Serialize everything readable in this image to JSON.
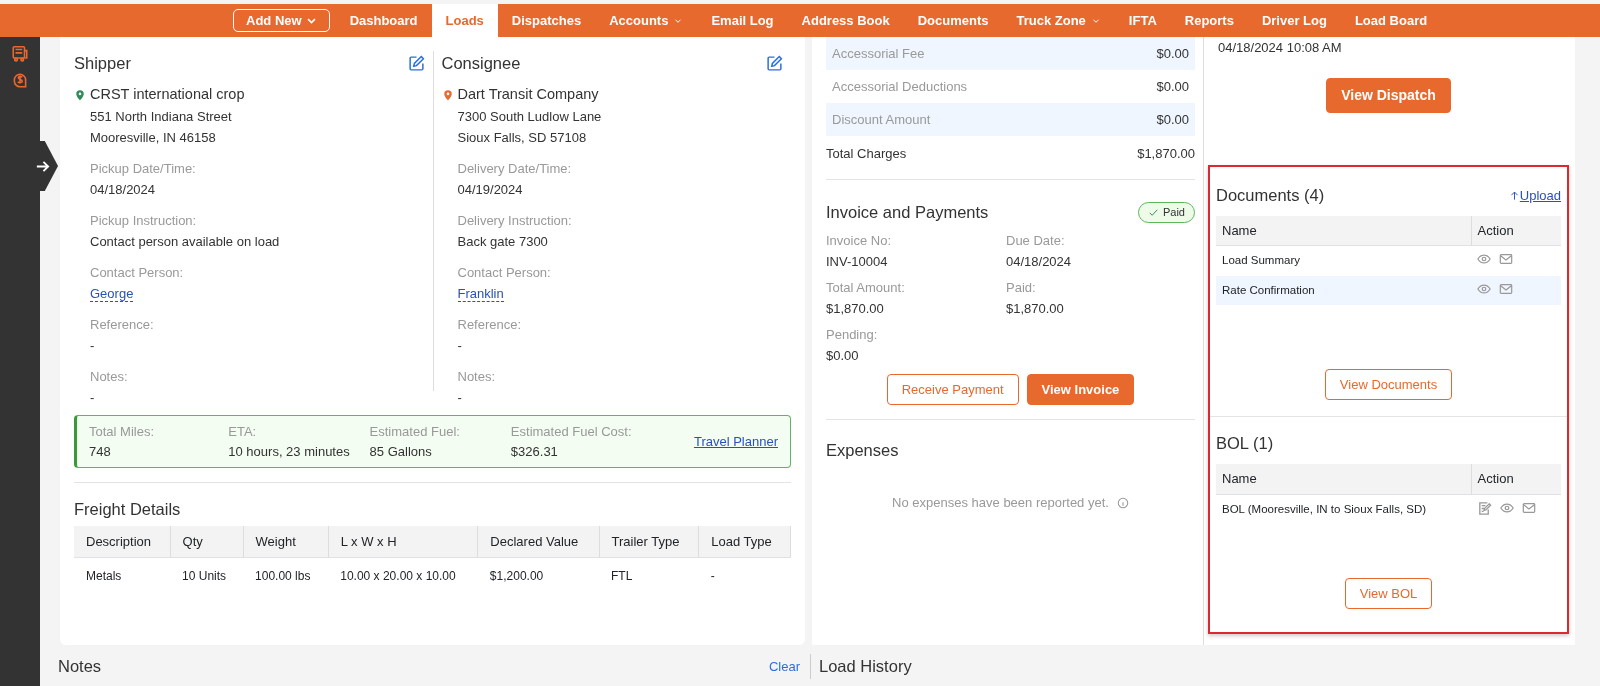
{
  "nav": {
    "add_new": "Add New",
    "items": [
      {
        "label": "Dashboard",
        "dropdown": false,
        "selected": false
      },
      {
        "label": "Loads",
        "dropdown": false,
        "selected": true
      },
      {
        "label": "Dispatches",
        "dropdown": false,
        "selected": false
      },
      {
        "label": "Accounts",
        "dropdown": true,
        "selected": false
      },
      {
        "label": "Email Log",
        "dropdown": false,
        "selected": false
      },
      {
        "label": "Address Book",
        "dropdown": false,
        "selected": false
      },
      {
        "label": "Documents",
        "dropdown": false,
        "selected": false
      },
      {
        "label": "Truck Zone",
        "dropdown": true,
        "selected": false
      },
      {
        "label": "IFTA",
        "dropdown": false,
        "selected": false
      },
      {
        "label": "Reports",
        "dropdown": false,
        "selected": false
      },
      {
        "label": "Driver Log",
        "dropdown": false,
        "selected": false
      },
      {
        "label": "Load Board",
        "dropdown": false,
        "selected": false
      }
    ]
  },
  "stops": [
    {
      "title": "Shipper",
      "color": "#2e8b57",
      "company": "CRST international crop",
      "address_lines": [
        "551 North Indiana Street",
        "Mooresville, IN 46158"
      ],
      "fields": [
        {
          "label": "Pickup Date/Time:",
          "value": "04/18/2024",
          "kind": "text"
        },
        {
          "label": "Pickup Instruction:",
          "value": "Contact person available on load",
          "kind": "text"
        },
        {
          "label": "Contact Person:",
          "value": "George",
          "kind": "link"
        },
        {
          "label": "Reference:",
          "value": "-",
          "kind": "text"
        },
        {
          "label": "Notes:",
          "value": "-",
          "kind": "text"
        }
      ]
    },
    {
      "title": "Consignee",
      "color": "#e8692e",
      "company": "Dart Transit Company",
      "address_lines": [
        "7300 South Ludlow Lane",
        "Sioux Falls, SD 57108"
      ],
      "fields": [
        {
          "label": "Delivery Date/Time:",
          "value": "04/19/2024",
          "kind": "text"
        },
        {
          "label": "Delivery Instruction:",
          "value": "Back gate 7300",
          "kind": "text"
        },
        {
          "label": "Contact Person:",
          "value": "Franklin",
          "kind": "link"
        },
        {
          "label": "Reference:",
          "value": "-",
          "kind": "text"
        },
        {
          "label": "Notes:",
          "value": "-",
          "kind": "text"
        }
      ]
    }
  ],
  "route_summary": {
    "fields": [
      {
        "label": "Total Miles:",
        "value": "748"
      },
      {
        "label": "ETA:",
        "value": "10 hours, 23 minutes"
      },
      {
        "label": "Estimated Fuel:",
        "value": "85 Gallons"
      },
      {
        "label": "Estimated Fuel Cost:",
        "value": "$326.31"
      }
    ],
    "link": "Travel Planner"
  },
  "freight": {
    "title": "Freight Details",
    "columns": [
      "Description",
      "Qty",
      "Weight",
      "L x W x H",
      "Declared Value",
      "Trailer Type",
      "Load Type"
    ],
    "rows": [
      [
        "Metals",
        "10 Units",
        "100.00 lbs",
        "10.00 x 20.00 x 10.00",
        "$1,200.00",
        "FTL",
        "-"
      ]
    ]
  },
  "charges": {
    "rows": [
      {
        "label": "Accessorial Fee",
        "amount": "$0.00",
        "highlighted": true
      },
      {
        "label": "Accessorial Deductions",
        "amount": "$0.00",
        "highlighted": false
      },
      {
        "label": "Discount Amount",
        "amount": "$0.00",
        "highlighted": true
      }
    ],
    "total": {
      "label": "Total Charges",
      "amount": "$1,870.00"
    }
  },
  "invoice": {
    "title": "Invoice and Payments",
    "status": "Paid",
    "fields": [
      {
        "label": "Invoice No:",
        "value": "INV-10004"
      },
      {
        "label": "Due Date:",
        "value": "04/18/2024"
      },
      {
        "label": "Total Amount:",
        "value": "$1,870.00"
      },
      {
        "label": "Paid:",
        "value": "$1,870.00"
      },
      {
        "label": "Pending:",
        "value": "$0.00"
      }
    ],
    "buttons": [
      {
        "label": "Receive Payment",
        "kind": "outline"
      },
      {
        "label": "View Invoice",
        "kind": "solid"
      }
    ]
  },
  "expenses": {
    "title": "Expenses",
    "empty_message": "No expenses have been reported yet."
  },
  "dispatch": {
    "timestamp": "04/18/2024 10:08 AM",
    "button": "View Dispatch"
  },
  "documents": {
    "title": "Documents (4)",
    "upload": "Upload",
    "columns": [
      "Name",
      "Action"
    ],
    "rows": [
      {
        "name": "Load Summary",
        "highlighted": false,
        "editable": false
      },
      {
        "name": "Rate Confirmation",
        "highlighted": true,
        "editable": false
      }
    ],
    "button": "View Documents"
  },
  "bol": {
    "title": "BOL (1)",
    "columns": [
      "Name",
      "Action"
    ],
    "rows": [
      {
        "name": "BOL (Mooresville, IN to Sioux Falls, SD)",
        "highlighted": false,
        "editable": true
      }
    ],
    "button": "View BOL"
  },
  "notes": {
    "title": "Notes",
    "clear": "Clear"
  },
  "load_history": {
    "title": "Load History"
  }
}
